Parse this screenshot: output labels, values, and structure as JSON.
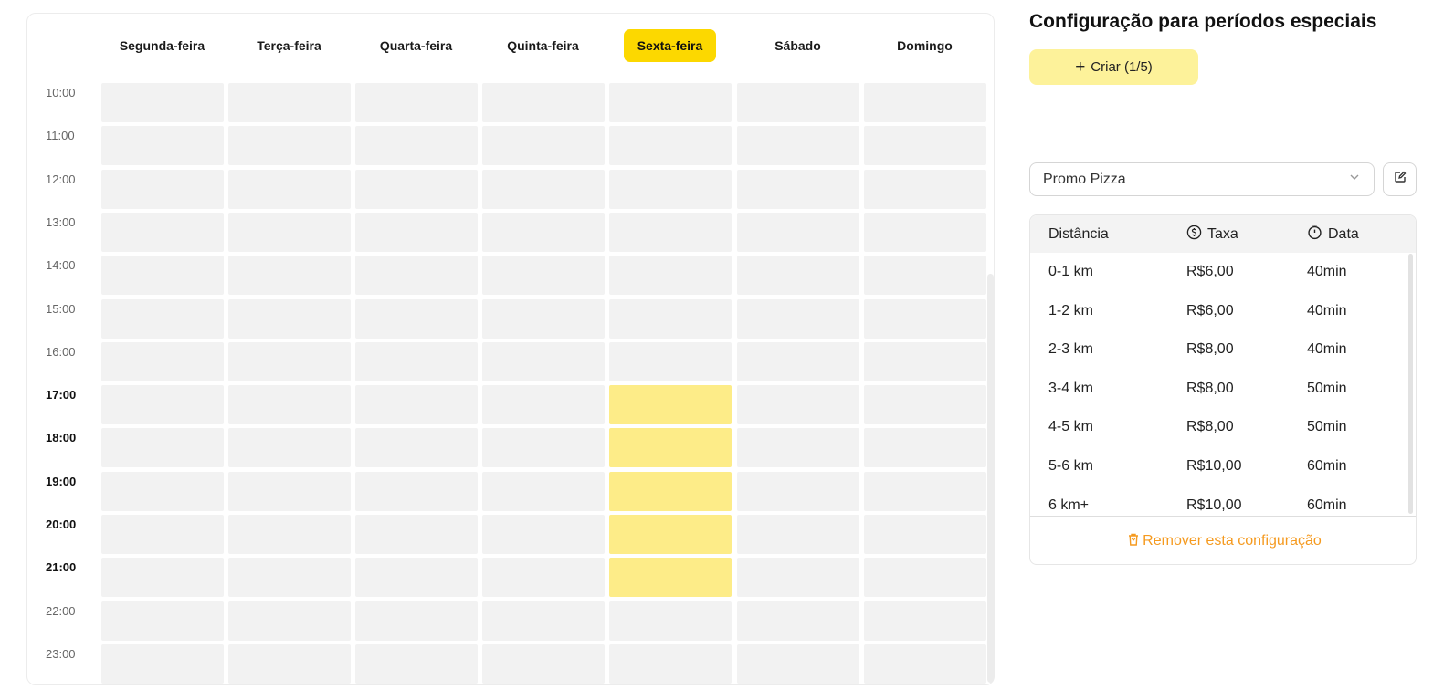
{
  "schedule": {
    "days": [
      {
        "label": "Segunda-feira",
        "active": false
      },
      {
        "label": "Terça-feira",
        "active": false
      },
      {
        "label": "Quarta-feira",
        "active": false
      },
      {
        "label": "Quinta-feira",
        "active": false
      },
      {
        "label": "Sexta-feira",
        "active": true
      },
      {
        "label": "Sábado",
        "active": false
      },
      {
        "label": "Domingo",
        "active": false
      }
    ],
    "hours": [
      {
        "label": "10:00",
        "bold": false,
        "selected_days": []
      },
      {
        "label": "11:00",
        "bold": false,
        "selected_days": []
      },
      {
        "label": "12:00",
        "bold": false,
        "selected_days": []
      },
      {
        "label": "13:00",
        "bold": false,
        "selected_days": []
      },
      {
        "label": "14:00",
        "bold": false,
        "selected_days": []
      },
      {
        "label": "15:00",
        "bold": false,
        "selected_days": []
      },
      {
        "label": "16:00",
        "bold": false,
        "selected_days": []
      },
      {
        "label": "17:00",
        "bold": true,
        "selected_days": [
          4
        ]
      },
      {
        "label": "18:00",
        "bold": true,
        "selected_days": [
          4
        ]
      },
      {
        "label": "19:00",
        "bold": true,
        "selected_days": [
          4
        ]
      },
      {
        "label": "20:00",
        "bold": true,
        "selected_days": [
          4
        ]
      },
      {
        "label": "21:00",
        "bold": true,
        "selected_days": [
          4
        ]
      },
      {
        "label": "22:00",
        "bold": false,
        "selected_days": []
      },
      {
        "label": "23:00",
        "bold": false,
        "selected_days": []
      }
    ],
    "colors": {
      "cell": "#f2f2f2",
      "selected_cell": "#fdec88",
      "active_day": "#fcd800"
    }
  },
  "panel": {
    "title": "Configuração para períodos especiais",
    "create_label": "Criar (1/5)",
    "select_value": "Promo Pizza",
    "table": {
      "headers": {
        "distance": "Distância",
        "fee": "Taxa",
        "date": "Data"
      },
      "rows": [
        {
          "distance": "0-1 km",
          "fee": "R$6,00",
          "time": "40min"
        },
        {
          "distance": "1-2 km",
          "fee": "R$6,00",
          "time": "40min"
        },
        {
          "distance": "2-3 km",
          "fee": "R$8,00",
          "time": "40min"
        },
        {
          "distance": "3-4 km",
          "fee": "R$8,00",
          "time": "50min"
        },
        {
          "distance": "4-5 km",
          "fee": "R$8,00",
          "time": "50min"
        },
        {
          "distance": "5-6 km",
          "fee": "R$10,00",
          "time": "60min"
        },
        {
          "distance": "6 km+",
          "fee": "R$10,00",
          "time": "60min"
        }
      ]
    },
    "remove_label": "Remover esta configuração",
    "colors": {
      "create_bg": "#fdf29a",
      "remove_text": "#f59a1f"
    }
  }
}
